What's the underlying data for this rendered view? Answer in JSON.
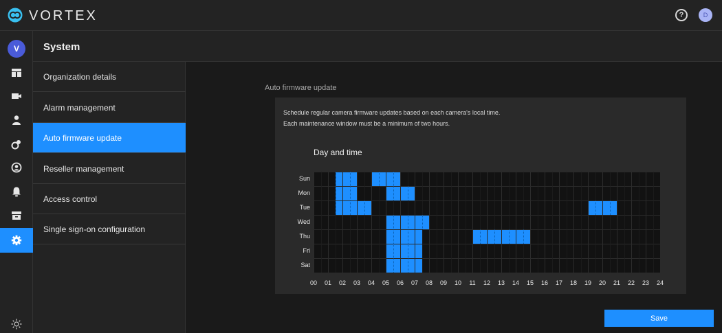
{
  "app": {
    "brand": "VORTEX",
    "avatar_initial": "V",
    "user_initial": "D",
    "help_icon": "help-circle-icon"
  },
  "header": {
    "title": "System"
  },
  "rail_items": [
    {
      "icon": "dashboard-icon"
    },
    {
      "icon": "camera-icon"
    },
    {
      "icon": "user-icon"
    },
    {
      "icon": "tags-icon"
    },
    {
      "icon": "account-circle-icon"
    },
    {
      "icon": "bell-icon"
    },
    {
      "icon": "archive-icon"
    },
    {
      "icon": "gear-icon",
      "active": true
    }
  ],
  "rail_footer_icon": "sun-icon",
  "subnav": {
    "items": [
      {
        "label": "Organization details"
      },
      {
        "label": "Alarm management"
      },
      {
        "label": "Auto firmware update",
        "active": true
      },
      {
        "label": "Reseller management"
      },
      {
        "label": "Access control"
      },
      {
        "label": "Single sign-on configuration"
      }
    ]
  },
  "main": {
    "section_title": "Auto firmware update",
    "description_line1": "Schedule regular camera firmware updates based on each camera's local time.",
    "description_line2": "Each maintenance window must be a minimum of two hours.",
    "schedule_heading": "Day and time",
    "save_label": "Save"
  },
  "schedule": {
    "days": [
      "Sun",
      "Mon",
      "Tue",
      "Wed",
      "Thu",
      "Fri",
      "Sat"
    ],
    "hours": [
      "00",
      "01",
      "02",
      "03",
      "04",
      "05",
      "06",
      "07",
      "08",
      "09",
      "10",
      "11",
      "12",
      "13",
      "14",
      "15",
      "16",
      "17",
      "18",
      "19",
      "20",
      "21",
      "22",
      "23",
      "24"
    ],
    "slots_per_hour": 2,
    "selected": {
      "Sun": [
        [
          1.5,
          3.0
        ],
        [
          4.0,
          6.0
        ]
      ],
      "Mon": [
        [
          1.5,
          3.0
        ],
        [
          5.0,
          7.0
        ]
      ],
      "Tue": [
        [
          1.5,
          4.0
        ],
        [
          19.0,
          21.0
        ]
      ],
      "Wed": [
        [
          5.0,
          8.0
        ]
      ],
      "Thu": [
        [
          5.0,
          7.5
        ],
        [
          11.0,
          15.0
        ]
      ],
      "Fri": [
        [
          5.0,
          7.5
        ]
      ],
      "Sat": [
        [
          5.0,
          7.5
        ]
      ]
    },
    "selected_color": "#1e8fff",
    "empty_color": "#121212"
  }
}
